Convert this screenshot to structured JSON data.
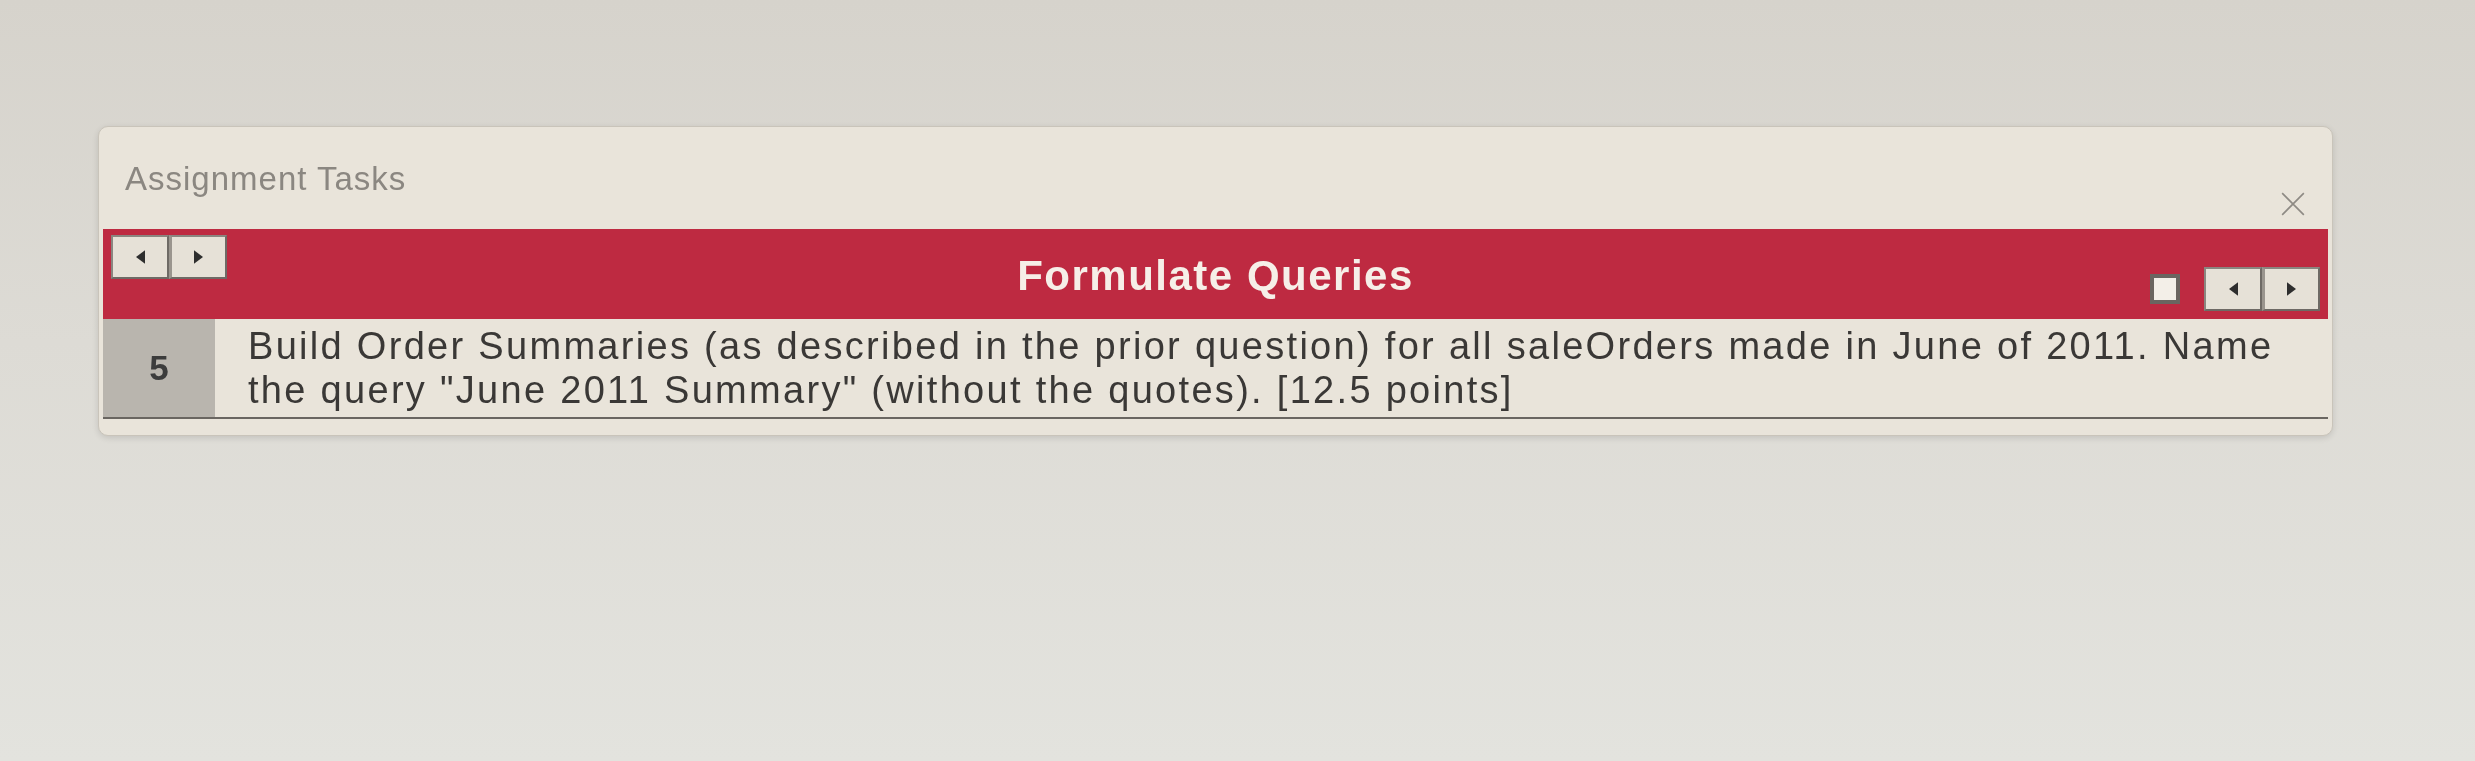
{
  "window": {
    "title": "Assignment Tasks"
  },
  "section": {
    "title": "Formulate Queries"
  },
  "question": {
    "number": "5",
    "text": "Build Order Summaries (as described in the prior question) for all saleOrders made in June of 2011. Name the query \"June 2011 Summary\" (without the quotes). [12.5 points]"
  }
}
